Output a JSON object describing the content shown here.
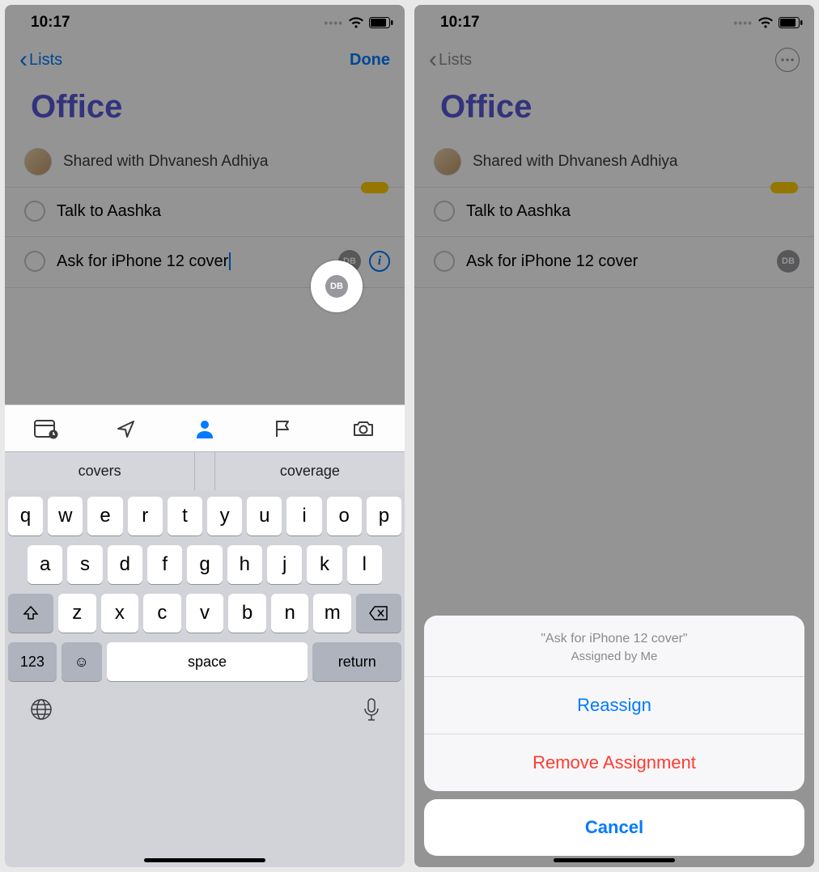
{
  "left": {
    "status": {
      "time": "10:17"
    },
    "nav": {
      "back": "Lists",
      "done": "Done"
    },
    "title": "Office",
    "shared_with": "Shared with Dhvanesh Adhiya",
    "reminders": {
      "r0": {
        "text": "Talk to Aashka"
      },
      "r1": {
        "text": "Ask for iPhone 12 cover",
        "assignee_initials": "DB"
      }
    },
    "suggestions": {
      "s0": "covers",
      "s1": "coverage"
    },
    "keyboard": {
      "row1": [
        "q",
        "w",
        "e",
        "r",
        "t",
        "y",
        "u",
        "i",
        "o",
        "p"
      ],
      "row2": [
        "a",
        "s",
        "d",
        "f",
        "g",
        "h",
        "j",
        "k",
        "l"
      ],
      "row3": [
        "z",
        "x",
        "c",
        "v",
        "b",
        "n",
        "m"
      ],
      "n123": "123",
      "space": "space",
      "return": "return"
    }
  },
  "right": {
    "status": {
      "time": "10:17"
    },
    "nav": {
      "back": "Lists"
    },
    "title": "Office",
    "shared_with": "Shared with Dhvanesh Adhiya",
    "reminders": {
      "r0": {
        "text": "Talk to Aashka"
      },
      "r1": {
        "text": "Ask for iPhone 12 cover",
        "assignee_initials": "DB"
      }
    },
    "sheet": {
      "title": "\"Ask for iPhone 12 cover\"",
      "subtitle": "Assigned by Me",
      "reassign": "Reassign",
      "remove": "Remove Assignment",
      "cancel": "Cancel"
    }
  }
}
